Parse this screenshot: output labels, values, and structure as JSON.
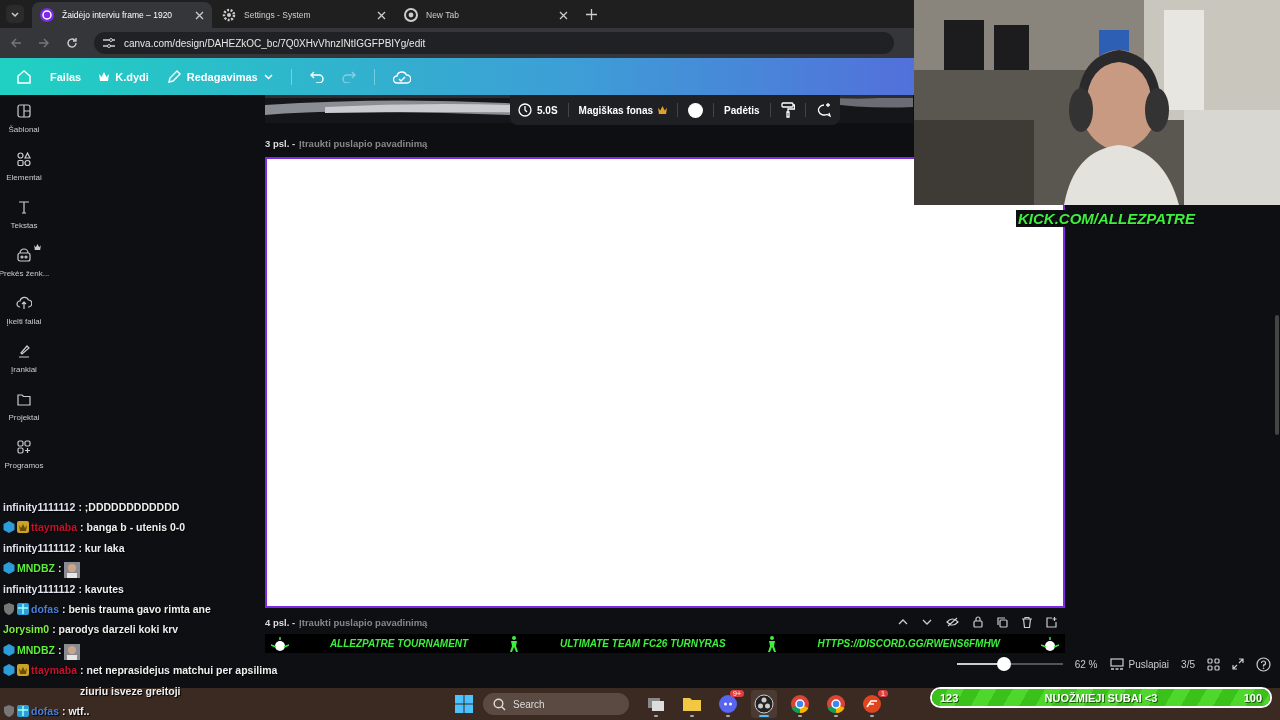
{
  "browser": {
    "tabs": [
      {
        "title": "Žaidėjo interviu frame – 1920",
        "kind": "canva",
        "selected": true
      },
      {
        "title": "Settings - System",
        "kind": "gear",
        "selected": false
      },
      {
        "title": "New Tab",
        "kind": "chrome",
        "selected": false
      }
    ],
    "url": "canva.com/design/DAHEZkOC_bc/7Q0XHvVhnzINtIGGFPBIYg/edit"
  },
  "header": {
    "menu": [
      {
        "label": "Failas",
        "kind": "plain"
      },
      {
        "label": "K.dydi",
        "kind": "crown"
      },
      {
        "label": "Redagavimas",
        "kind": "pencil"
      }
    ],
    "redo_disabled": true
  },
  "sidebar": {
    "items": [
      {
        "label": "Šablonai",
        "kind": "layout",
        "premium": false
      },
      {
        "label": "Elementai",
        "kind": "shapes",
        "premium": false
      },
      {
        "label": "Tekstas",
        "kind": "text",
        "premium": false
      },
      {
        "label": "Prekės ženk...",
        "kind": "brand",
        "premium": true
      },
      {
        "label": "Įkelti failai",
        "kind": "upload",
        "premium": false
      },
      {
        "label": "Įrankiai",
        "kind": "draw",
        "premium": false
      },
      {
        "label": "Projektai",
        "kind": "folder",
        "premium": false
      },
      {
        "label": "Programos",
        "kind": "apps",
        "premium": false
      }
    ]
  },
  "toolbar": {
    "duration": "5.0S",
    "magic": "Magiškas fonas",
    "position": "Padėtis"
  },
  "pages": [
    {
      "number": "3 psl. -",
      "placeholder": "Įtraukti puslapio pavadinimą"
    },
    {
      "number": "4 psl. -",
      "placeholder": "Įtraukti puslapio pavadinimą"
    }
  ],
  "banner": [
    "ALLEZPATRE TOURNAMENT",
    "ULTIMATE TEAM FC26 TURNYRAS",
    "HTTPS://DISCORD.GG/RWENS6FMHW"
  ],
  "zoom": {
    "level": 0.45,
    "reading": "62 %",
    "pages_label": "Puslapiai",
    "page_count": "3/5"
  },
  "taskbar": {
    "search": {
      "placeholder": "Search"
    },
    "apps": [
      {
        "kind": "taskview",
        "selected": false
      },
      {
        "kind": "folder",
        "selected": false
      },
      {
        "kind": "discord",
        "badge": "9+",
        "selected": false
      },
      {
        "kind": "obs",
        "selected": true
      },
      {
        "kind": "chrome",
        "selected": false
      },
      {
        "kind": "chrome",
        "selected": false
      },
      {
        "kind": "ea",
        "badge": "1",
        "selected": false
      }
    ]
  },
  "overlay": {
    "kick": "KICK.COM/ALLEZPATRE",
    "chat": [
      {
        "user": "infinity1111112",
        "color": "#dfe3f0",
        "text": ": ;DDDDDDDDDDDD"
      },
      {
        "user": "ttaymaba",
        "color": "#c8102e",
        "badges": [
          {
            "kind": "cube"
          },
          {
            "kind": "crown"
          }
        ],
        "text": ": banga b - utenis 0-0"
      },
      {
        "user": "infinity1111112",
        "color": "#dfe3f0",
        "text": ": kur laka"
      },
      {
        "user": "MNDBZ",
        "color": "#5cf03c",
        "badges": [
          {
            "kind": "cube"
          }
        ],
        "text": ":",
        "emote": true
      },
      {
        "user": "infinity1111112",
        "color": "#dfe3f0",
        "text": ": kavutes"
      },
      {
        "user": "dofas",
        "color": "#4a7fd8",
        "badges": [
          {
            "kind": "shield"
          },
          {
            "kind": "gift"
          }
        ],
        "text": ": benis trauma gavo rimta ane"
      },
      {
        "user": "Jorysim0",
        "color": "#7ef03c",
        "text": ": parodys darzeli koki krv"
      },
      {
        "user": "MNDBZ",
        "color": "#5cf03c",
        "badges": [
          {
            "kind": "cube"
          }
        ],
        "text": ":",
        "emote": true
      },
      {
        "user": "ttaymaba",
        "color": "#c8102e",
        "badges": [
          {
            "kind": "cube"
          },
          {
            "kind": "crown"
          }
        ],
        "text": ": net neprasidejus matchui per apsilima ziuriu isveze greitoji"
      },
      {
        "user": "dofas",
        "color": "#4a7fd8",
        "badges": [
          {
            "kind": "shield"
          },
          {
            "kind": "gift"
          }
        ],
        "text": ": wtf.."
      }
    ],
    "goal": {
      "current": "123",
      "title": "NUOŽMIEJI SUBAI <3",
      "target": "100",
      "level": 1
    }
  }
}
